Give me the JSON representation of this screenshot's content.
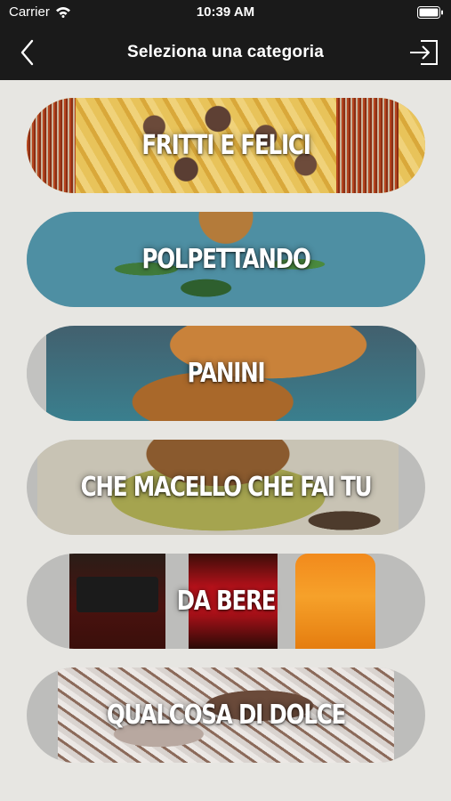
{
  "status_bar": {
    "carrier": "Carrier",
    "time": "10:39 AM",
    "wifi_icon": "wifi-icon",
    "battery_icon": "battery-icon"
  },
  "nav": {
    "title": "Seleziona una categoria",
    "back_icon": "chevron-left-icon",
    "logout_icon": "logout-icon"
  },
  "categories": [
    {
      "label": "FRITTI E FELICI"
    },
    {
      "label": "POLPETTANDO"
    },
    {
      "label": "PANINI"
    },
    {
      "label": "CHE MACELLO CHE FAI TU"
    },
    {
      "label": "DA BERE"
    },
    {
      "label": "QUALCOSA DI DOLCE"
    }
  ],
  "colors": {
    "bar_bg": "#1a1a1a",
    "page_bg": "#e7e6e2",
    "label_text": "#ffffff"
  }
}
